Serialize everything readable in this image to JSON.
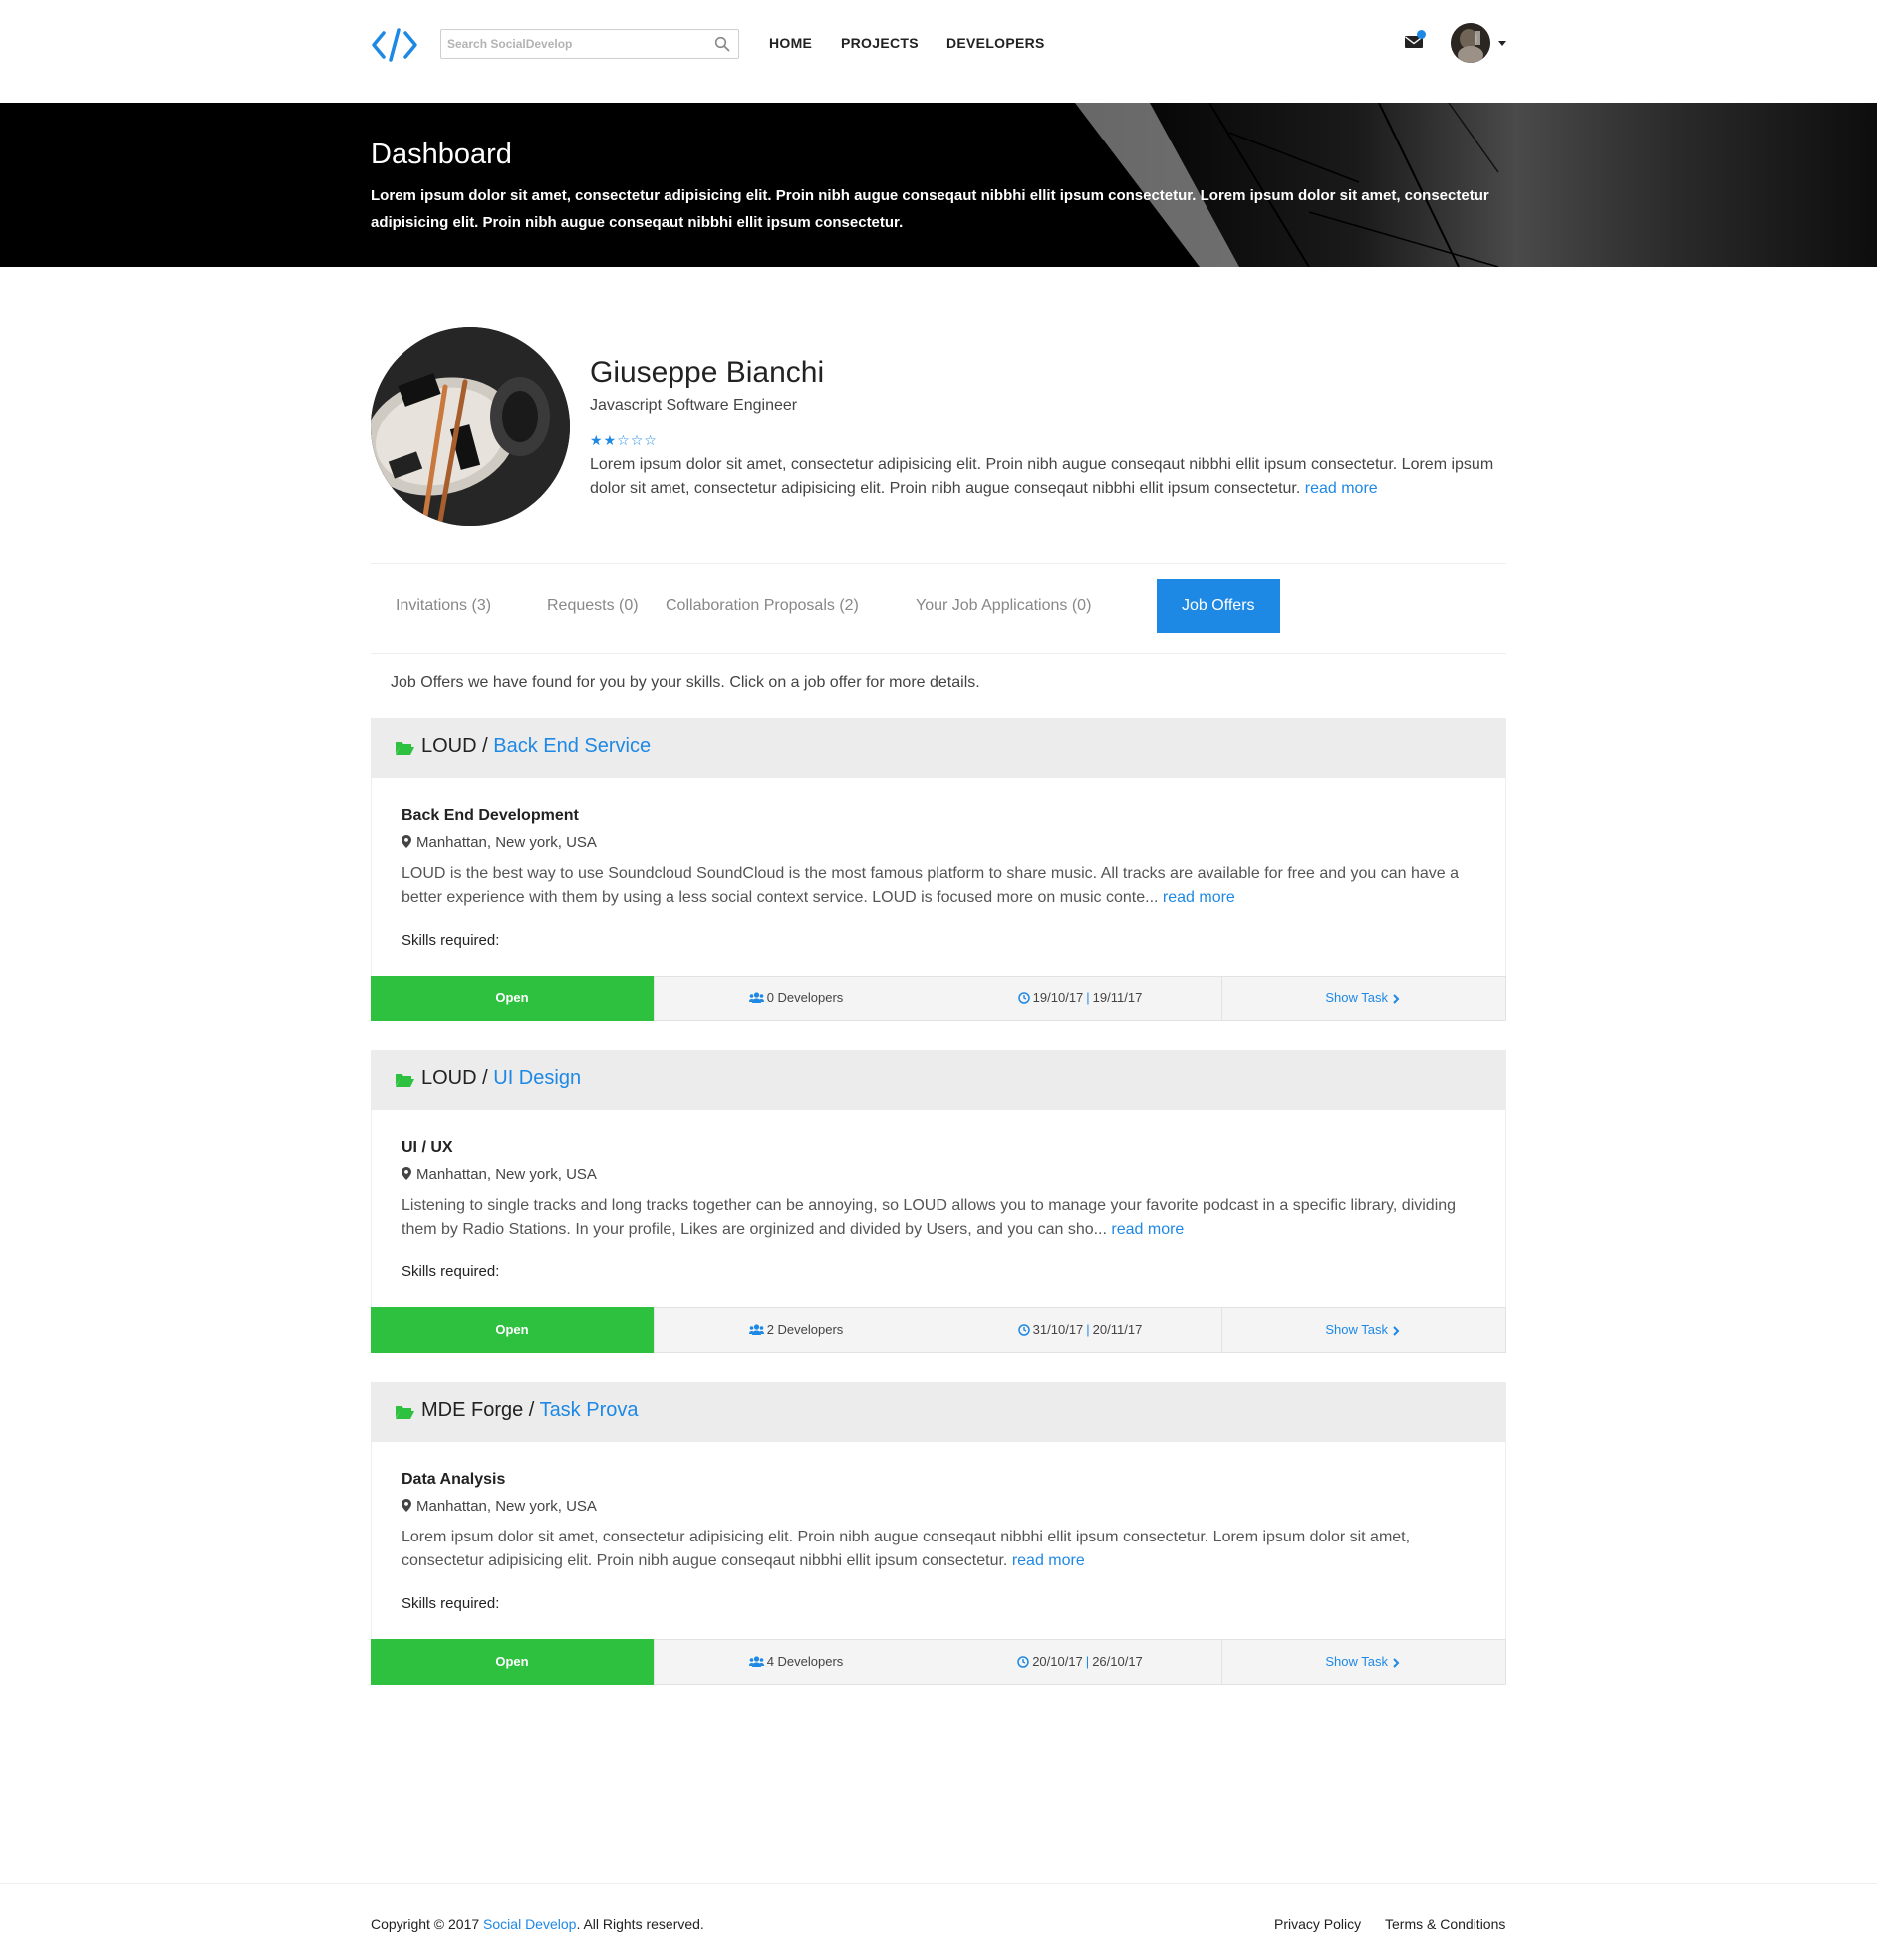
{
  "nav": {
    "search_placeholder": "Search SocialDevelop",
    "links": [
      "HOME",
      "PROJECTS",
      "DEVELOPERS"
    ],
    "icons": {
      "logo": "code-icon",
      "search": "search-icon",
      "mail": "envelope-icon"
    }
  },
  "hero": {
    "title": "Dashboard",
    "text": "Lorem ipsum dolor sit amet, consectetur adipisicing elit. Proin nibh augue conseqaut nibbhi ellit ipsum consectetur. Lorem ipsum dolor sit amet, consectetur adipisicing elit. Proin nibh augue conseqaut nibbhi ellit ipsum consectetur."
  },
  "profile": {
    "name": "Giuseppe Bianchi",
    "role": "Javascript Software Engineer",
    "rating": 2,
    "rating_max": 5,
    "bio": "Lorem ipsum dolor sit amet, consectetur adipisicing elit. Proin nibh augue conseqaut nibbhi ellit ipsum consectetur. Lorem ipsum dolor sit amet, consectetur adipisicing elit. Proin nibh augue conseqaut nibbhi ellit ipsum consectetur. ",
    "read_more": "read more"
  },
  "tabs": [
    {
      "label": "Invitations (3)"
    },
    {
      "label": "Requests (0)"
    },
    {
      "label": "Collaboration Proposals (2)"
    },
    {
      "label": "Your Job Applications (0)"
    },
    {
      "label": "Job Offers",
      "active": true
    }
  ],
  "intro": "Job Offers we have found for you by your skills. Click on a job offer for more details.",
  "jobs": [
    {
      "project": "LOUD",
      "sep": " / ",
      "task": "Back End Service",
      "name": "Back End Development",
      "location": "Manhattan, New york, USA",
      "desc": "LOUD is the best way to use Soundcloud SoundCloud is the most famous platform to share music. All tracks are available for free and you can have a better experience with them by using a less social context service. LOUD is focused more on music conte... ",
      "read_more": "read more",
      "skills": "Skills required:",
      "status": "Open",
      "developers": "0 Developers",
      "start": "19/10/17",
      "divider": "|",
      "end": "19/11/17",
      "show": "Show Task"
    },
    {
      "project": "LOUD",
      "sep": " / ",
      "task": "UI Design",
      "name": "UI / UX",
      "location": "Manhattan, New york, USA",
      "desc": "Listening to single tracks and long tracks together can be annoying, so LOUD allows you to manage your favorite podcast in a specific library, dividing them by Radio Stations. In your profile, Likes are orginized and divided by Users, and you can sho... ",
      "read_more": "read more",
      "skills": "Skills required:",
      "status": "Open",
      "developers": "2 Developers",
      "start": "31/10/17",
      "divider": "|",
      "end": "20/11/17",
      "show": "Show Task"
    },
    {
      "project": "MDE Forge",
      "sep": " / ",
      "task": "Task Prova",
      "name": "Data Analysis",
      "location": "Manhattan, New york, USA",
      "desc": "Lorem ipsum dolor sit amet, consectetur adipisicing elit. Proin nibh augue conseqaut nibbhi ellit ipsum consectetur. Lorem ipsum dolor sit amet, consectetur adipisicing elit. Proin nibh augue conseqaut nibbhi ellit ipsum consectetur. ",
      "read_more": "read more",
      "skills": "Skills required:",
      "status": "Open",
      "developers": "4 Developers",
      "start": "20/10/17",
      "divider": "|",
      "end": "26/10/17",
      "show": "Show Task"
    }
  ],
  "footer": {
    "copy_prefix": "Copyright © 2017 ",
    "brand": "Social Develop",
    "copy_suffix": ". All Rights reserved.",
    "links": [
      "Privacy Policy",
      "Terms & Conditions"
    ]
  },
  "colors": {
    "accent": "#1e88e5",
    "status_open": "#2ec140",
    "hero_bg": "#000000"
  }
}
